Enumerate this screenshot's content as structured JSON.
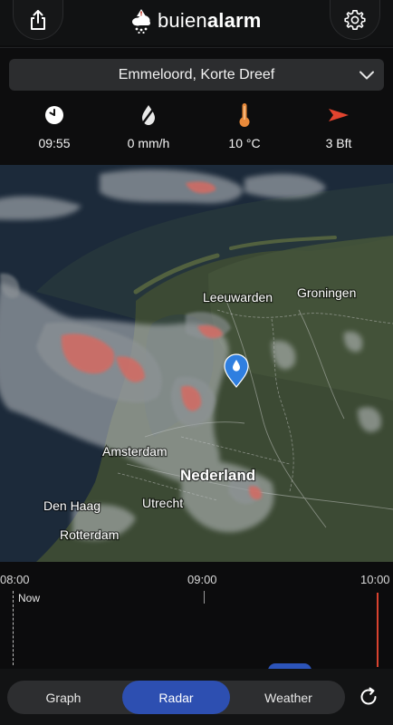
{
  "header": {
    "brand_regular": "buien",
    "brand_bold": "alarm"
  },
  "location": {
    "selected": "Emmeloord, Korte Dreef"
  },
  "stats": {
    "time": "09:55",
    "precipitation": "0 mm/h",
    "temperature": "10 °C",
    "wind": "3 Bft"
  },
  "map": {
    "cities": [
      "Leeuwarden",
      "Groningen",
      "Amsterdam",
      "Utrecht",
      "Den Haag",
      "Rotterdam"
    ],
    "country": "Nederland"
  },
  "timeline": {
    "labels": [
      "08:00",
      "09:00",
      "10:00"
    ],
    "now_label": "Now"
  },
  "tabs": {
    "graph": "Graph",
    "radar": "Radar",
    "weather": "Weather",
    "active": "Radar"
  },
  "colors": {
    "accent": "#2d4fb1",
    "temperature_icon": "#e8893a",
    "wind_icon": "#e2442f",
    "marker": "#2f7fe0"
  }
}
